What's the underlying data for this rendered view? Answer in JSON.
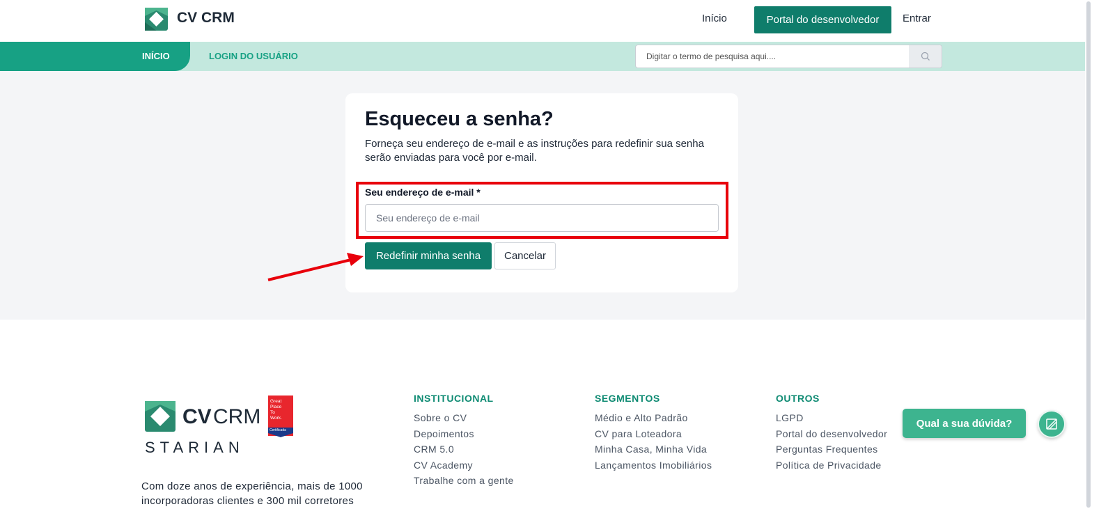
{
  "header": {
    "logo_text": "CV CRM",
    "nav": {
      "inicio": "Início",
      "portal": "Portal do desenvolvedor",
      "entrar": "Entrar"
    }
  },
  "subnav": {
    "tabs": [
      {
        "label": "INÍCIO",
        "active": true
      },
      {
        "label": "LOGIN DO USUÁRIO",
        "active": false
      }
    ],
    "search": {
      "placeholder": "Digitar o termo de pesquisa aqui...."
    }
  },
  "form": {
    "title": "Esqueceu a senha?",
    "description": "Forneça seu endereço de e-mail e as instruções para redefinir sua senha serão enviadas para você por e-mail.",
    "email_label": "Seu endereço de e-mail *",
    "email_placeholder": "Seu endereço de e-mail",
    "email_value": "",
    "submit_label": "Redefinir minha senha",
    "cancel_label": "Cancelar"
  },
  "footer": {
    "logo": {
      "brand": "CVCRM",
      "sub": "STARIAN",
      "badge": "Great Place To Work. Certificada"
    },
    "description": "Com doze anos de experiência, mais de 1000 incorporadoras clientes e 300 mil corretores",
    "columns": [
      {
        "title": "INSTITUCIONAL",
        "items": [
          "Sobre o CV",
          "Depoimentos",
          "CRM 5.0",
          "CV Academy",
          "Trabalhe com a gente"
        ]
      },
      {
        "title": "SEGMENTOS",
        "items": [
          "Médio e Alto Padrão",
          "CV para Loteadora",
          "Minha Casa, Minha Vida",
          "Lançamentos Imobiliários"
        ]
      },
      {
        "title": "OUTROS",
        "items": [
          "LGPD",
          "Portal do desenvolvedor",
          "Perguntas Frequentes",
          "Política de Privacidade"
        ]
      }
    ]
  },
  "help": {
    "label": "Qual a sua dúvida?"
  },
  "colors": {
    "brand": "#0f7d6b",
    "accent": "#17a184",
    "subnav_bg": "#c3e8de",
    "highlight": "#e8000b",
    "help": "#3db48f"
  },
  "icons": [
    "cvcrm-logo-icon",
    "search-icon",
    "arrow-annotation",
    "chat-icon"
  ]
}
